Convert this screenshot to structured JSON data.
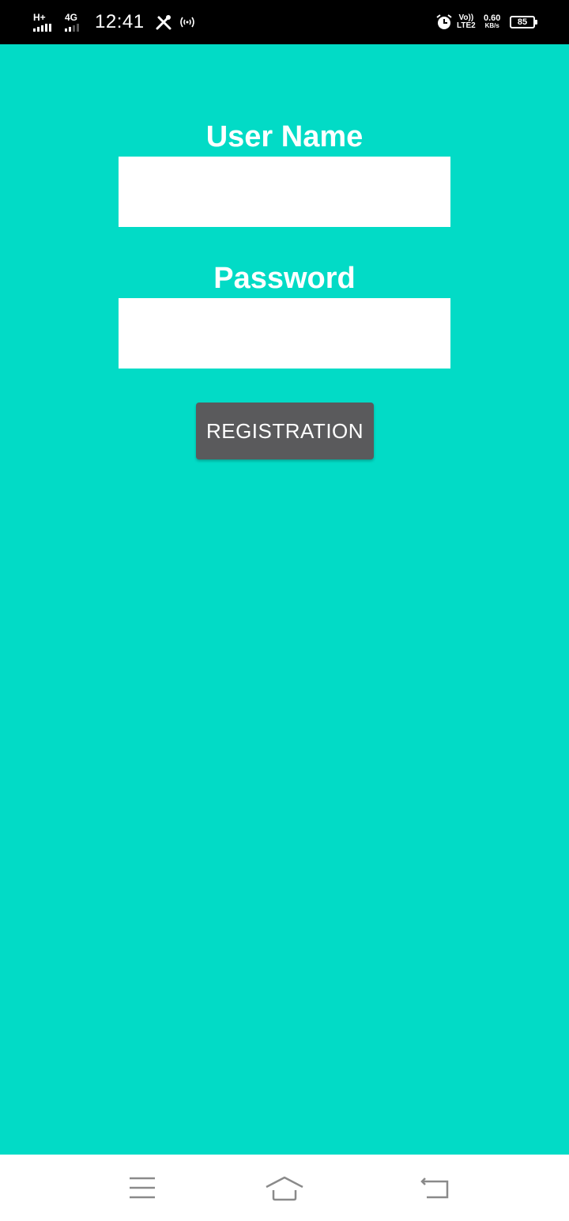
{
  "status_bar": {
    "network_1": "H+",
    "network_2": "4G",
    "time": "12:41",
    "volte": "Vo))",
    "lte": "LTE2",
    "speed_value": "0.60",
    "speed_unit": "KB/s",
    "battery": "85",
    "icons": [
      "signal-icon",
      "tools-icon",
      "hotspot-icon",
      "alarm-icon",
      "battery-icon"
    ]
  },
  "form": {
    "username_label": "User Name",
    "username_value": "",
    "password_label": "Password",
    "password_value": "",
    "register_button": "REGISTRATION"
  },
  "nav_bar": {
    "icons": [
      "menu-icon",
      "home-icon",
      "back-icon"
    ]
  },
  "colors": {
    "background": "#02DBC6",
    "button": "#5A5A5C",
    "text": "#FFFFFF"
  }
}
